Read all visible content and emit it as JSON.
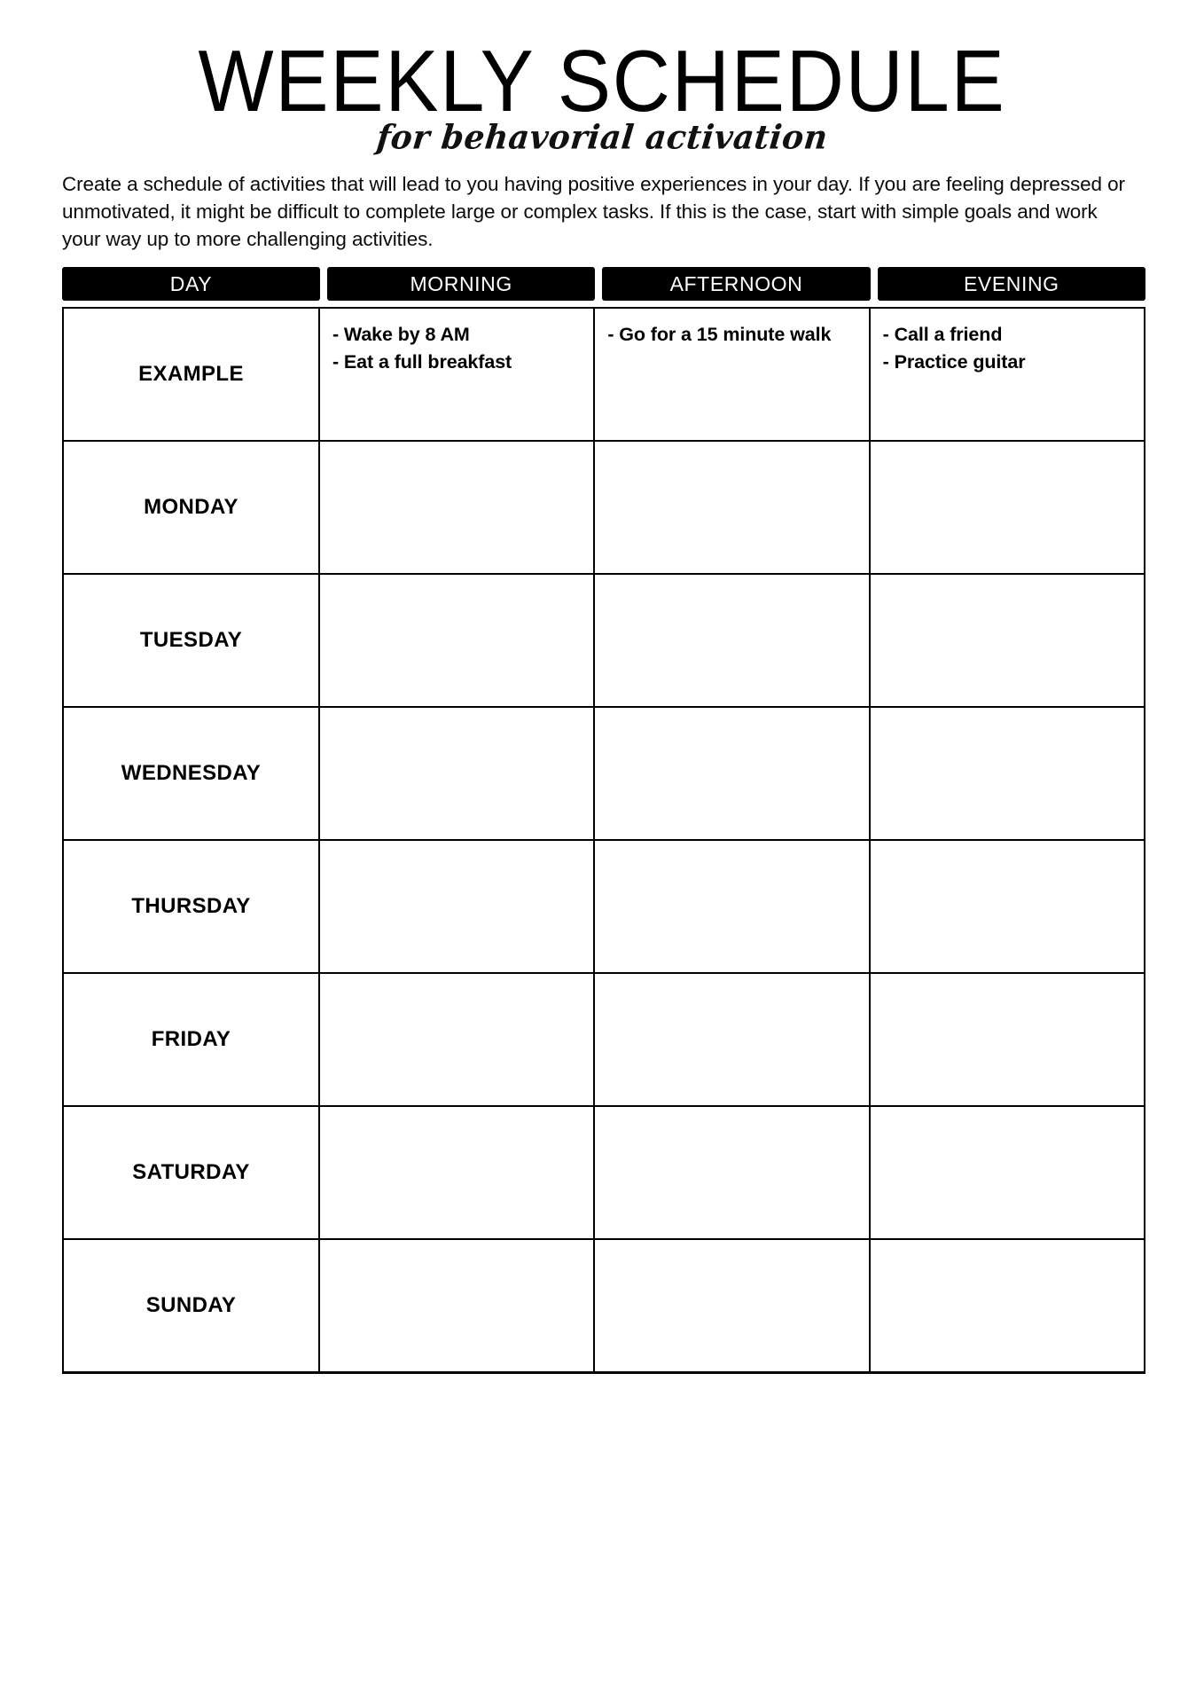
{
  "header": {
    "title": "WEEKLY SCHEDULE",
    "subtitle": "for behavorial activation"
  },
  "intro": {
    "text": "Create a schedule of activities that will lead to you having positive experiences in your day. If you are feeling depressed or unmotivated, it might be difficult to complete large or complex tasks. If this is the case, start with simple goals and work your way up to more challenging activities."
  },
  "table": {
    "columns": [
      "DAY",
      "MORNING",
      "AFTERNOON",
      "EVENING"
    ],
    "rows": [
      {
        "day": "EXAMPLE",
        "morning": [
          "- Wake by 8 AM",
          "- Eat a full breakfast"
        ],
        "afternoon": [
          "- Go for a 15 minute walk"
        ],
        "evening": [
          "- Call a friend",
          "- Practice guitar"
        ]
      },
      {
        "day": "MONDAY",
        "morning": [],
        "afternoon": [],
        "evening": []
      },
      {
        "day": "TUESDAY",
        "morning": [],
        "afternoon": [],
        "evening": []
      },
      {
        "day": "WEDNESDAY",
        "morning": [],
        "afternoon": [],
        "evening": []
      },
      {
        "day": "THURSDAY",
        "morning": [],
        "afternoon": [],
        "evening": []
      },
      {
        "day": "FRIDAY",
        "morning": [],
        "afternoon": [],
        "evening": []
      },
      {
        "day": "SATURDAY",
        "morning": [],
        "afternoon": [],
        "evening": []
      },
      {
        "day": "SUNDAY",
        "morning": [],
        "afternoon": [],
        "evening": []
      }
    ]
  },
  "colors": {
    "header_background": "#000000",
    "header_text": "#ffffff",
    "page_background": "#ffffff",
    "border": "#000000",
    "body_text": "#0b0b0b"
  }
}
